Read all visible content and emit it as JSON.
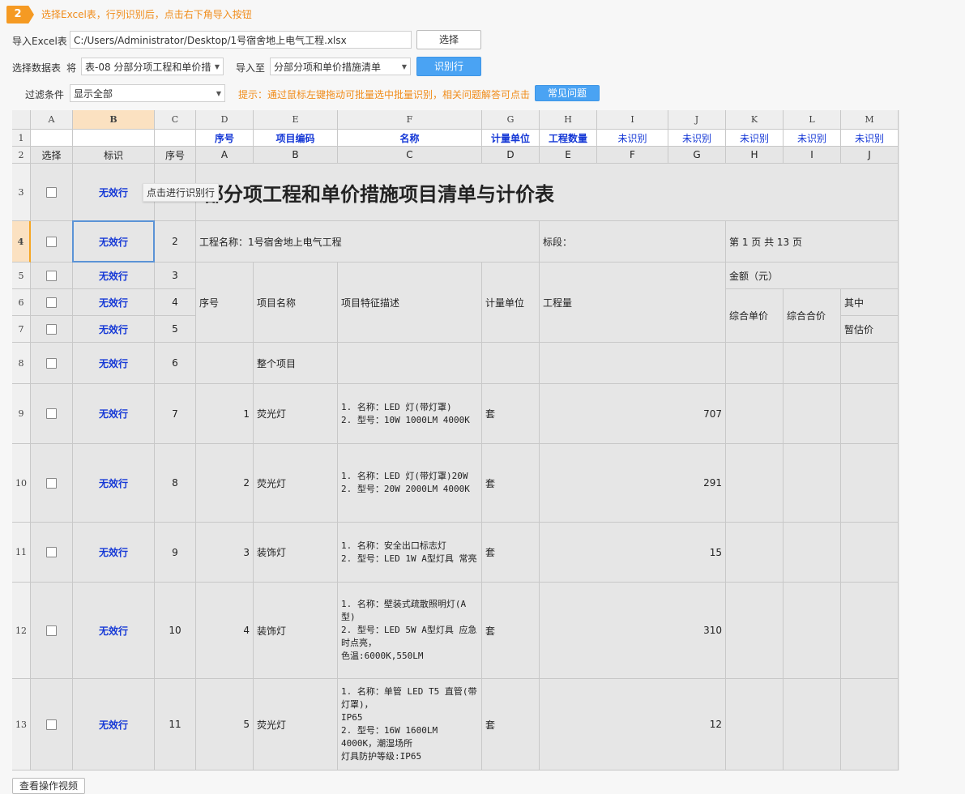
{
  "step": {
    "number": "2",
    "hint": "选择Excel表，行列识别后，点击右下角导入按钮"
  },
  "import_row": {
    "label": "导入Excel表",
    "path": "C:/Users/Administrator/Desktop/1号宿舍地上电气工程.xlsx",
    "choose_button": "选择"
  },
  "sheet_row": {
    "label": "选择数据表",
    "jiang": "将",
    "sheet_value": "表-08 分部分项工程和单价措",
    "import_to_label": "导入至",
    "target_value": "分部分项和单价措施清单",
    "identify_button": "识别行"
  },
  "filter_row": {
    "label": "过滤条件",
    "value": "显示全部",
    "tip": "提示：通过鼠标左键拖动可批量选中批量识别，相关问题解答可点击",
    "faq_button": "常见问题"
  },
  "columns": [
    "A",
    "B",
    "C",
    "D",
    "E",
    "F",
    "G",
    "H",
    "I",
    "J",
    "K",
    "L",
    "M"
  ],
  "mapping_row": [
    "",
    "",
    "",
    "序号",
    "项目编码",
    "名称",
    "计量单位",
    "工程数量",
    "未识别",
    "未识别",
    "未识别",
    "未识别",
    "未识别"
  ],
  "header_row": [
    "选择",
    "标识",
    "序号",
    "A",
    "B",
    "C",
    "D",
    "E",
    "F",
    "G",
    "H",
    "I",
    "J"
  ],
  "row_numbers": [
    "1",
    "2",
    "3",
    "4",
    "5",
    "6",
    "7",
    "8",
    "9",
    "10",
    "11",
    "12",
    "13"
  ],
  "rows": [
    {
      "ident": "无效行",
      "seq": ""
    },
    {
      "ident": "无效行",
      "seq": "2"
    },
    {
      "ident": "无效行",
      "seq": "3"
    },
    {
      "ident": "无效行",
      "seq": "4"
    },
    {
      "ident": "无效行",
      "seq": "5"
    },
    {
      "ident": "无效行",
      "seq": "6"
    },
    {
      "ident": "无效行",
      "seq": "7"
    },
    {
      "ident": "无效行",
      "seq": "8"
    },
    {
      "ident": "无效行",
      "seq": "9"
    },
    {
      "ident": "无效行",
      "seq": "10"
    },
    {
      "ident": "无效行",
      "seq": "11"
    }
  ],
  "tooltip": "点击进行识别行",
  "sheet": {
    "title": "部分项工程和单价措施项目清单与计价表",
    "project_name": "工程名称：1号宿舍地上电气工程",
    "section": "标段：",
    "page": "第 1 页  共 13 页",
    "h_seq": "序号",
    "h_name": "项目名称",
    "h_desc": "项目特征描述",
    "h_unit": "计量单位",
    "h_qty": "工程量",
    "h_amount": "金额（元）",
    "h_unit_price": "综合单价",
    "h_total": "综合合价",
    "h_among": "其中",
    "h_est": "暂估价",
    "whole_project": "整个项目",
    "items": [
      {
        "no": "1",
        "name": "荧光灯",
        "desc": "1. 名称：LED 灯(带灯罩)\n2. 型号：10W 1000LM 4000K",
        "unit": "套",
        "qty": "707"
      },
      {
        "no": "2",
        "name": "荧光灯",
        "desc": "1. 名称：LED 灯(带灯罩)20W\n2. 型号：20W 2000LM 4000K",
        "unit": "套",
        "qty": "291"
      },
      {
        "no": "3",
        "name": "装饰灯",
        "desc": "1. 名称：安全出口标志灯\n2. 型号：LED 1W A型灯具 常亮",
        "unit": "套",
        "qty": "15"
      },
      {
        "no": "4",
        "name": "装饰灯",
        "desc": "1. 名称：壁装式疏散照明灯(A型)\n2. 型号：LED 5W A型灯具 应急时点亮，\n色温:6000K,550LM",
        "unit": "套",
        "qty": "310"
      },
      {
        "no": "5",
        "name": "荧光灯",
        "desc": "1. 名称：单管 LED T5 直管(带灯罩)，\nIP65\n2. 型号：16W 1600LM 4000K，潮湿场所\n灯具防护等级:IP65",
        "unit": "套",
        "qty": "12"
      }
    ]
  },
  "bottom_button": "查看操作视频"
}
